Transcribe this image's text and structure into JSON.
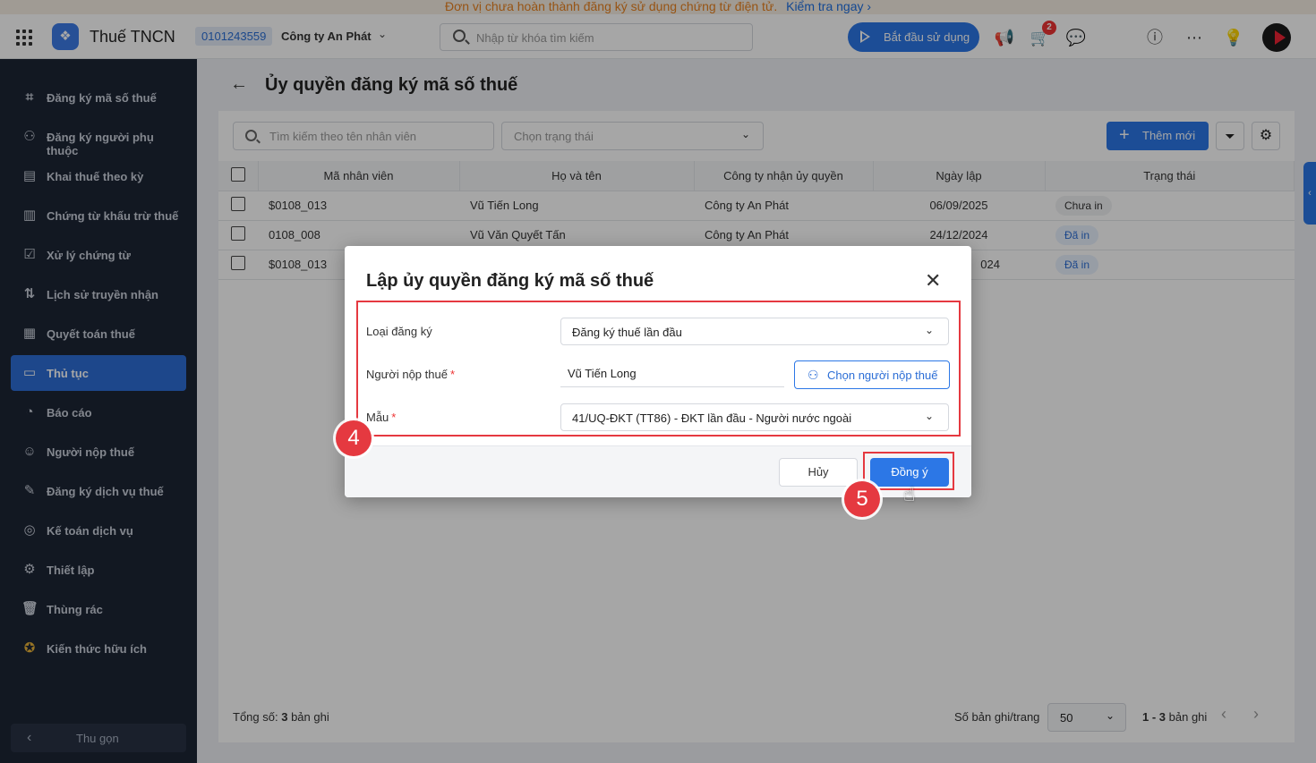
{
  "banner": {
    "message": "Đơn vị chưa hoàn thành đăng ký sử dụng chứng từ điện tử.",
    "link": "Kiểm tra ngay"
  },
  "topbar": {
    "app_name": "Thuế TNCN",
    "tax_code": "0101243559",
    "company": "Công ty An Phát",
    "search_placeholder": "Nhập từ khóa tìm kiếm",
    "start_button": "Bắt đầu sử dụng",
    "cart_badge": "2"
  },
  "sidebar": {
    "items": [
      {
        "label": "Đăng ký mã số thuế",
        "icon": "id-scan-icon"
      },
      {
        "label": "Đăng ký người phụ thuộc",
        "icon": "people-icon"
      },
      {
        "label": "Khai thuế theo kỳ",
        "icon": "document-icon"
      },
      {
        "label": "Chứng từ khấu trừ thuế",
        "icon": "receipt-icon"
      },
      {
        "label": "Xử lý chứng từ",
        "icon": "document-check-icon"
      },
      {
        "label": "Lịch sử truyền nhận",
        "icon": "transfer-icon"
      },
      {
        "label": "Quyết toán thuế",
        "icon": "settlement-icon"
      },
      {
        "label": "Thủ tục",
        "icon": "procedure-icon"
      },
      {
        "label": "Báo cáo",
        "icon": "pie-chart-icon"
      },
      {
        "label": "Người nộp thuế",
        "icon": "taxpayer-icon"
      },
      {
        "label": "Đăng ký dịch vụ thuế",
        "icon": "service-icon"
      },
      {
        "label": "Kế toán dịch vụ",
        "icon": "accounting-icon"
      },
      {
        "label": "Thiết lập",
        "icon": "gear-icon"
      },
      {
        "label": "Thùng rác",
        "icon": "trash-icon"
      },
      {
        "label": "Kiến thức hữu ích",
        "icon": "knowledge-icon"
      }
    ],
    "active_item": "Thủ tục",
    "collapse_label": "Thu gọn"
  },
  "page": {
    "title": "Ủy quyền đăng ký mã số thuế",
    "search_placeholder": "Tìm kiếm theo tên nhân viên",
    "status_placeholder": "Chọn trạng thái",
    "add_button": "Thêm mới"
  },
  "table": {
    "columns": [
      "Mã nhân viên",
      "Họ và tên",
      "Công ty nhận ủy quyền",
      "Ngày lập",
      "Trạng thái"
    ],
    "rows": [
      {
        "code": "$0108_013",
        "name": "Vũ Tiến Long",
        "company": "Công ty An Phát",
        "date": "06/09/2025",
        "status": "Chưa in"
      },
      {
        "code": "0108_008",
        "name": "Vũ Văn Quyết Tấn",
        "company": "Công ty An Phát",
        "date": "24/12/2024",
        "status": "Đã in"
      },
      {
        "code": "$0108_013",
        "name": "",
        "company": "",
        "date": "024",
        "status": "Đã in"
      }
    ]
  },
  "footer": {
    "total_prefix": "Tổng số:",
    "total_count": "3",
    "total_suffix": "bản ghi",
    "per_page_label": "Số bản ghi/trang",
    "per_page_value": "50",
    "range": "1 - 3",
    "range_suffix": "bản ghi"
  },
  "modal": {
    "title": "Lập ủy quyền đăng ký mã số thuế",
    "reg_type_label": "Loại đăng ký",
    "reg_type_value": "Đăng ký thuế lần đầu",
    "taxpayer_label": "Người nộp thuế",
    "taxpayer_value": "Vũ Tiến Long",
    "choose_taxpayer_button": "Chọn người nộp thuế",
    "template_label": "Mẫu",
    "template_value": "41/UQ-ĐKT (TT86) - ĐKT lần đầu - Người nước ngoài",
    "cancel_button": "Hủy",
    "ok_button": "Đồng ý"
  },
  "annotations": {
    "step_a": "4",
    "step_b": "5"
  },
  "colors": {
    "primary": "#2c77e6",
    "sidebar_bg": "#1d2535",
    "highlight": "#e53940"
  }
}
